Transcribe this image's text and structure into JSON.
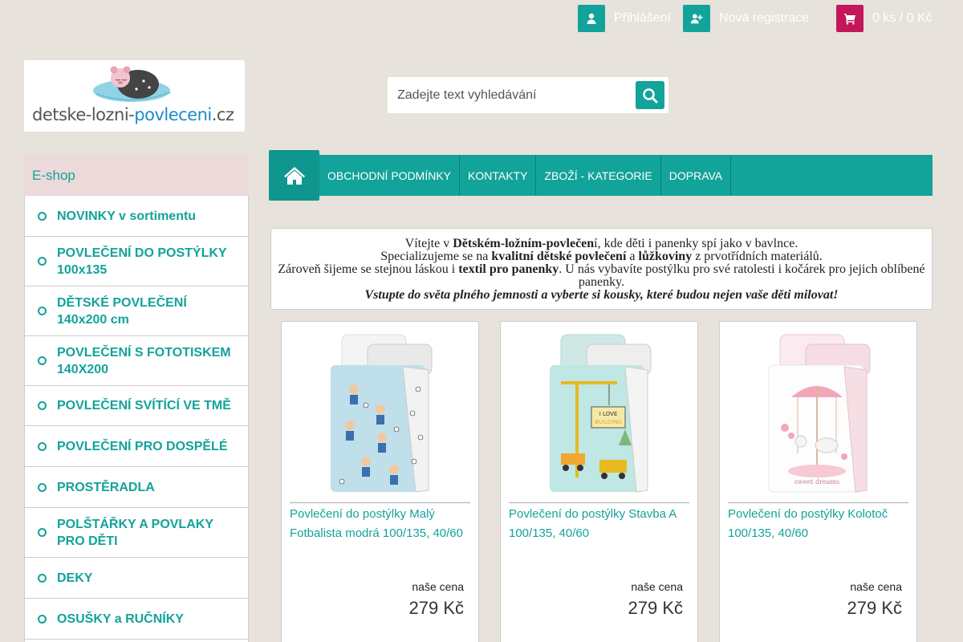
{
  "topbar": {
    "login": {
      "label": "Přihlášení",
      "icon": "user-icon"
    },
    "register": {
      "label": "Nová registrace",
      "icon": "user-plus-icon"
    },
    "cart": {
      "label": "0 ks / 0 Kč",
      "icon": "cart-icon"
    }
  },
  "logo": {
    "text_main": "detske-lozni-",
    "text_accent": "povleceni",
    "text_tld": ".cz"
  },
  "search": {
    "placeholder": "Zadejte text vyhledávání",
    "value": "",
    "icon": "search-icon"
  },
  "sidebar": {
    "heading": "E-shop",
    "items": [
      {
        "label": "NOVINKY v sortimentu"
      },
      {
        "label": "POVLEČENÍ DO POSTÝLKY 100x135"
      },
      {
        "label": "DĚTSKÉ POVLEČENÍ 140x200 cm"
      },
      {
        "label": "POVLEČENÍ S FOTOTISKEM 140X200"
      },
      {
        "label": "POVLEČENÍ SVÍTÍCÍ VE TMĚ"
      },
      {
        "label": "POVLEČENÍ PRO DOSPĚLÉ"
      },
      {
        "label": "PROSTĚRADLA"
      },
      {
        "label": "POLŠTÁŘKY A POVLAKY PRO DĚTI"
      },
      {
        "label": "DEKY"
      },
      {
        "label": "OSUŠKY a RUČNÍKY"
      }
    ]
  },
  "nav": {
    "home_icon": "home-icon",
    "items": [
      {
        "label": "OBCHODNÍ PODMÍNKY"
      },
      {
        "label": "KONTAKTY"
      },
      {
        "label": "ZBOŽÍ - KATEGORIE"
      },
      {
        "label": "DOPRAVA"
      }
    ]
  },
  "welcome": {
    "l1_a": "Vítejte v ",
    "l1_b": "Dětském-ložním-povlečen",
    "l1_c": "í, kde děti i panenky spí jako v bavlnce.",
    "l2_a": "Specializujeme se na ",
    "l2_b": "kvalitní dětské povlečení",
    "l2_c": " a ",
    "l2_d": "lůžkoviny",
    "l2_e": " z prvotřídních materiálů.",
    "l3_a": "Zároveň šijeme se stejnou láskou i ",
    "l3_b": "textil pro panenky",
    "l3_c": ". U nás vybavíte postýlku pro své ratolesti i kočárek pro jejich oblíbené panenky.",
    "l4": "Vstupte do světa plného jemnosti a vyberte si kousky, které budou nejen vaše děti milovat!"
  },
  "products": [
    {
      "title": "Povlečení do postýlky Malý Fotbalista modrá 100/135, 40/60",
      "price_label": "naše cena",
      "price": "279 Kč"
    },
    {
      "title": "Povlečení do postýlky Stavba A 100/135, 40/60",
      "price_label": "naše cena",
      "price": "279 Kč"
    },
    {
      "title": "Povlečení do postýlky Kolotoč 100/135, 40/60",
      "price_label": "naše cena",
      "price": "279 Kč"
    }
  ],
  "colors": {
    "accent": "#12a39a",
    "cart": "#c2185b",
    "background": "#e8e2dc",
    "sidebar_head": "#ecd9da"
  }
}
